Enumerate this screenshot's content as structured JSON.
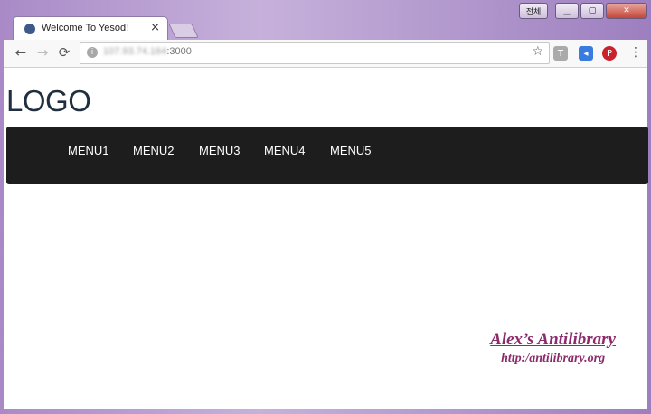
{
  "window": {
    "ko_button": "전체",
    "min_glyph": "▁",
    "max_glyph": "▢",
    "close_glyph": "✕"
  },
  "tab": {
    "title": "Welcome To Yesod!",
    "close_glyph": "×"
  },
  "toolbar": {
    "back_glyph": "←",
    "forward_glyph": "→",
    "reload_glyph": "⟳",
    "url_obscured": "107.93.74.164",
    "url_port": ":3000",
    "star_glyph": "☆",
    "ext1_glyph": "T",
    "ext2_glyph": "◂",
    "ext3_glyph": "P",
    "menu_glyph": "⋮"
  },
  "page": {
    "logo": "LOGO",
    "menu": [
      "MENU1",
      "MENU2",
      "MENU3",
      "MENU4",
      "MENU5"
    ]
  },
  "watermark": {
    "title": "Alex’s Antilibrary",
    "url": "http:/antilibrary.org"
  },
  "colors": {
    "navbar": "#1d1d1e",
    "logo": "#1f2f3f",
    "watermark": "#8c2a6c"
  }
}
